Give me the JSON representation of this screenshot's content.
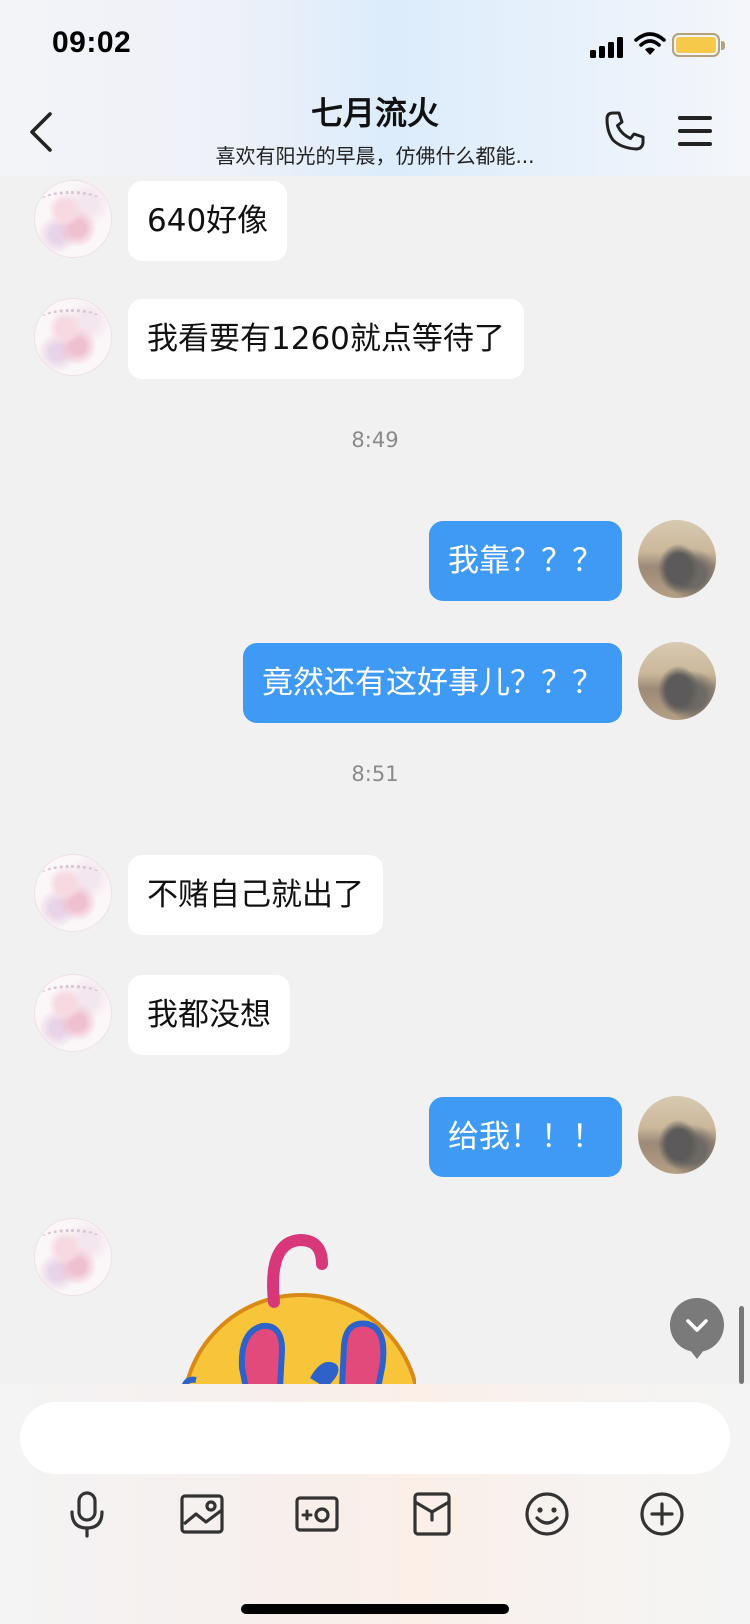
{
  "status_bar": {
    "time": "09:02"
  },
  "header": {
    "title": "七月流火",
    "subtitle": "喜欢有阳光的早晨，仿佛什么都能..."
  },
  "messages": [
    {
      "from": "them",
      "text": "640好像"
    },
    {
      "from": "them",
      "text": "我看要有1260就点等待了"
    },
    {
      "timestamp": "8:49"
    },
    {
      "from": "me",
      "text": "我靠？？？"
    },
    {
      "from": "me",
      "text": "竟然还有这好事儿？？？"
    },
    {
      "timestamp": "8:51"
    },
    {
      "from": "them",
      "text": "不赌自己就出了"
    },
    {
      "from": "them",
      "text": "我都没想"
    },
    {
      "from": "me",
      "text": "给我！！！"
    },
    {
      "from": "them",
      "sticker": "covering-eyes-emoji"
    }
  ],
  "input_bar": {
    "placeholder": ""
  },
  "toolbar": [
    "microphone-icon",
    "image-icon",
    "camera-icon",
    "red-packet-icon",
    "emoji-icon",
    "plus-icon"
  ],
  "colors": {
    "my_bubble": "#3f9af6",
    "their_bubble": "#ffffff",
    "background": "#f1f1f1"
  }
}
